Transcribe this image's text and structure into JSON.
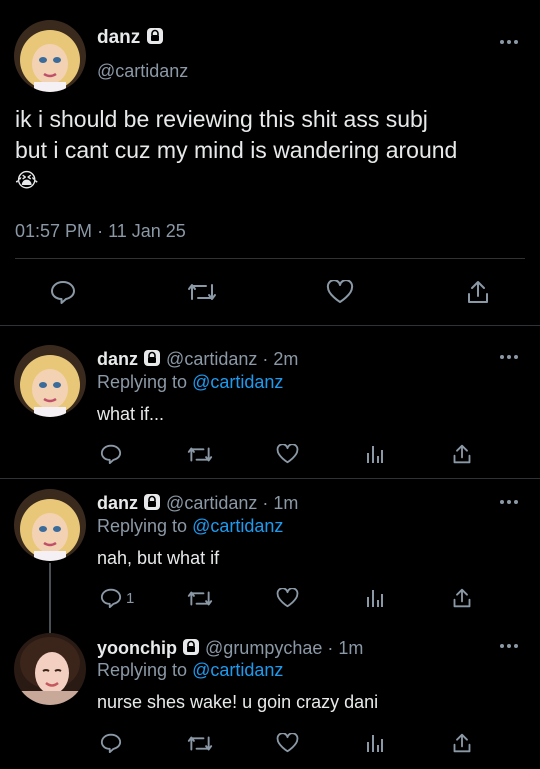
{
  "main_tweet": {
    "display_name": "danz",
    "handle": "@cartidanz",
    "text_line1": "ik i should be reviewing this shit ass subj",
    "text_line2": "but i cant cuz my mind is wandering around",
    "emoji": "😭",
    "time": "01:57 PM",
    "separator": "·",
    "date": "11 Jan 25"
  },
  "replies": [
    {
      "display_name": "danz",
      "handle": "@cartidanz",
      "time_ago": "· 2m",
      "replying_prefix": "Replying to",
      "replying_to": "@cartidanz",
      "text": "what if...",
      "reply_count": ""
    },
    {
      "display_name": "danz",
      "handle": "@cartidanz",
      "time_ago": "· 1m",
      "replying_prefix": "Replying to",
      "replying_to": "@cartidanz",
      "text": "nah, but what if",
      "reply_count": "1"
    },
    {
      "display_name": "yoonchip",
      "handle": "@grumpychae",
      "time_ago": "· 1m",
      "replying_prefix": "Replying to",
      "replying_to": "@cartidanz",
      "text": "nurse shes wake! u goin crazy dani",
      "reply_count": ""
    }
  ],
  "colors": {
    "background": "#000000",
    "text": "#e7e9ea",
    "secondary": "#8b98a5",
    "link": "#1d9bf0",
    "divider": "#2f3336"
  },
  "icons": [
    "more-icon",
    "lock-icon",
    "reply-icon",
    "retweet-icon",
    "like-icon",
    "share-icon",
    "analytics-icon"
  ]
}
